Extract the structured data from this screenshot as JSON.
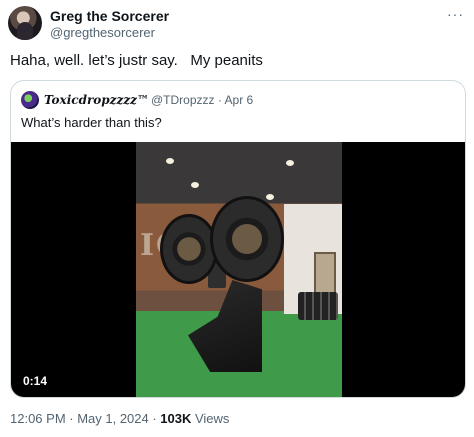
{
  "tweet": {
    "display_name": "Greg the Sorcerer",
    "handle": "@gregthesorcerer",
    "more_icon": "more-icon",
    "text": "Haha, well. let’s justr say.   My peanits"
  },
  "quote": {
    "display_name": "Toxicdropzzzz™",
    "meta": "@TDropzzz · Apr 6",
    "text": "What’s harder than this?",
    "video": {
      "duration": "0:14",
      "sign_text": "IC"
    }
  },
  "footer": {
    "time_date": "12:06 PM · May 1, 2024 · ",
    "views_count": "103K",
    "views_label": " Views"
  }
}
